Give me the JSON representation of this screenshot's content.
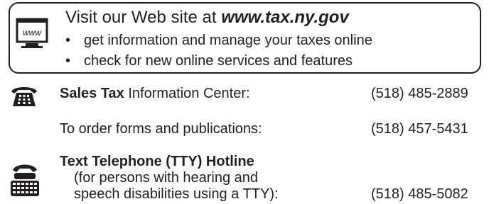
{
  "web_box": {
    "icon_label": "www",
    "heading_prefix": "Visit our Web site at ",
    "url": "www.tax.ny.gov",
    "bullets": [
      "get information and manage your taxes online",
      "check for new online services and features"
    ]
  },
  "sales_tax": {
    "title_bold": "Sales Tax",
    "title_rest": " Information Center:",
    "phone": "(518) 485-2889"
  },
  "forms": {
    "label": "To order forms and publications:",
    "phone": "(518) 457-5431"
  },
  "tty": {
    "title": "Text Telephone (TTY) Hotline",
    "line2": "(for persons with hearing and",
    "line3": "speech disabilities using a TTY):",
    "phone": "(518) 485-5082"
  },
  "icons": {
    "web": "www-monitor-icon",
    "phone": "telephone-icon",
    "tty": "tty-keyboard-icon"
  }
}
